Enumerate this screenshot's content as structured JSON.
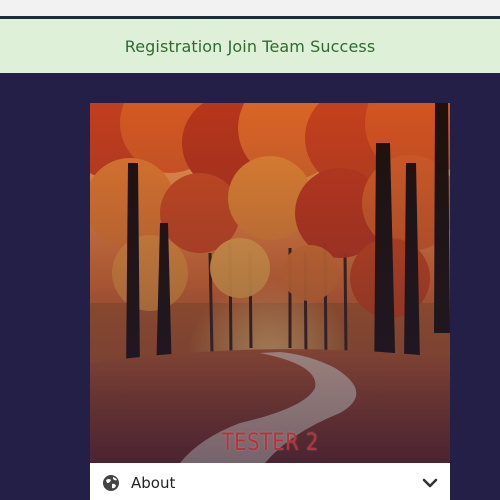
{
  "alert": {
    "message": "Registration Join Team Success",
    "background": "#dff0d8",
    "text_color": "#2f6b2f"
  },
  "card": {
    "photo": {
      "subject": "autumn forest path with red and orange foliage"
    },
    "name": "TESTER 2",
    "name_color": "#b8323a",
    "accordion": {
      "label": "About",
      "icon": "globe-icon",
      "toggle_icon": "chevron-down-icon"
    }
  },
  "colors": {
    "page_background": "#241f46",
    "top_rule": "#1f2c3c"
  }
}
